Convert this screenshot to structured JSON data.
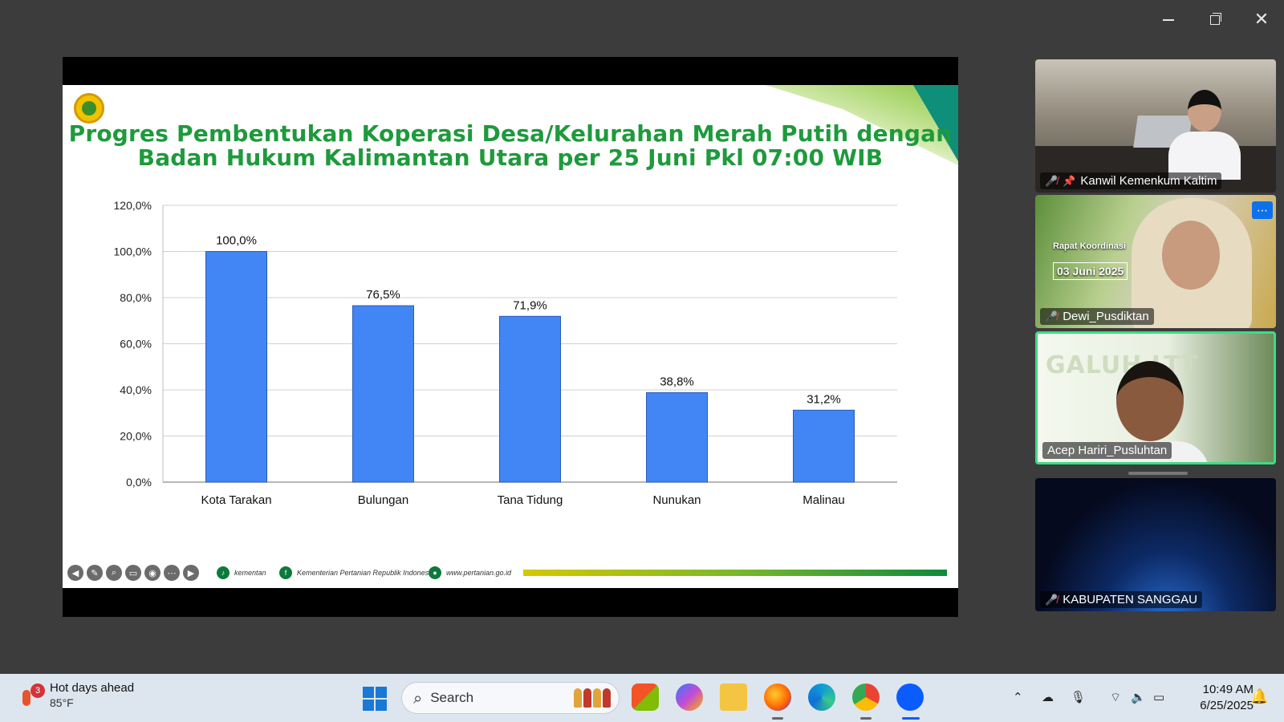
{
  "slide": {
    "title_line1": "Progres Pembentukan Koperasi Desa/Kelurahan Merah Putih dengan",
    "title_line2": "Badan Hukum Kalimantan Utara per 25 Juni Pkl 07:00 WIB",
    "footer": {
      "tiktok": "kementan",
      "facebook": "Kementerian Pertanian Republik Indonesia",
      "web": "www.pertanian.go.id"
    }
  },
  "chart_data": {
    "type": "bar",
    "categories": [
      "Kota Tarakan",
      "Bulungan",
      "Tana Tidung",
      "Nunukan",
      "Malinau"
    ],
    "values": [
      100.0,
      76.5,
      71.9,
      38.8,
      31.2
    ],
    "value_labels": [
      "100,0%",
      "76,5%",
      "71,9%",
      "38,8%",
      "31,2%"
    ],
    "yticks": [
      "0,0%",
      "20,0%",
      "40,0%",
      "60,0%",
      "80,0%",
      "100,0%",
      "120,0%"
    ],
    "ylim": [
      0,
      120
    ],
    "grid": true,
    "bar_color": "#4285f4"
  },
  "participants": [
    {
      "name": "Kanwil Kemenkum Kaltim",
      "muted": true,
      "pinned": true
    },
    {
      "name": "Dewi_Pusdiktan",
      "muted": true,
      "background_card": "Rapat Koordinasi",
      "background_date": "03 Juni 2025"
    },
    {
      "name": "Acep Hariri_Pusluhtan",
      "muted": false,
      "background_title": "GALUH LTT"
    },
    {
      "name": "KABUPATEN SANGGAU",
      "muted": true
    }
  ],
  "taskbar": {
    "weather_title": "Hot days ahead",
    "weather_temp": "85°F",
    "weather_badge": "3",
    "search_label": "Search",
    "time": "10:49 AM",
    "date": "6/25/2025"
  },
  "colors": {
    "title_green": "#1e9a3c",
    "active_speaker": "#3ddc84",
    "zoom_blue": "#0e71eb"
  }
}
